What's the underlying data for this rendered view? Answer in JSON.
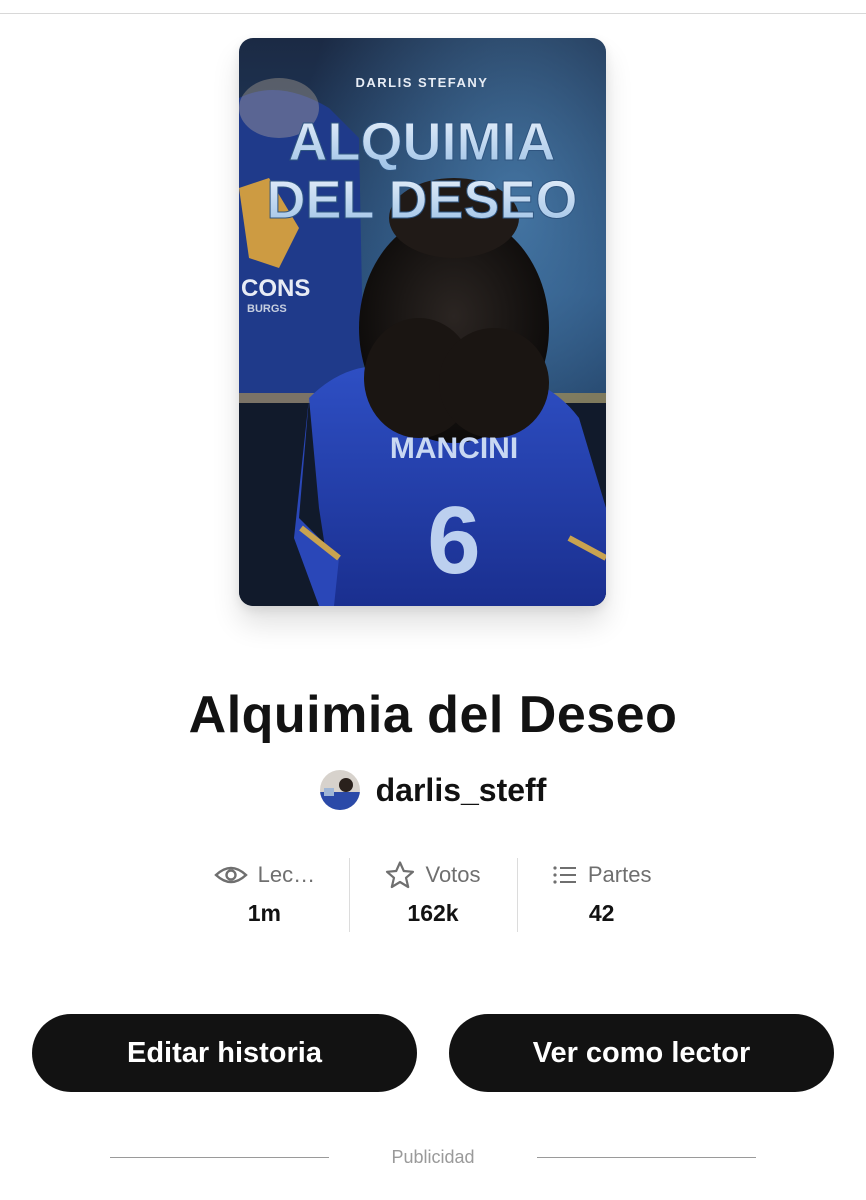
{
  "story": {
    "title": "Alquimia del Deseo",
    "author": "darlis_steff",
    "cover": {
      "author_line": "DARLIS STEFANY",
      "title_line_1": "ALQUIMIA",
      "title_line_2": "DEL DESEO",
      "jersey_name": "MANCINI",
      "jersey_number": "6",
      "background_text_1": "CONS",
      "background_text_2": "BURGS"
    }
  },
  "stats": [
    {
      "icon": "eye-icon",
      "label": "Lec…",
      "value": "1m"
    },
    {
      "icon": "star-icon",
      "label": "Votos",
      "value": "162k"
    },
    {
      "icon": "list-icon",
      "label": "Partes",
      "value": "42"
    }
  ],
  "actions": {
    "edit_label": "Editar historia",
    "read_label": "Ver como lector"
  },
  "ad": {
    "label": "Publicidad"
  },
  "colors": {
    "button_bg": "#121212",
    "button_text": "#ffffff",
    "muted_text": "#6f6f6f",
    "cover_blue": "#1f3fa8"
  }
}
